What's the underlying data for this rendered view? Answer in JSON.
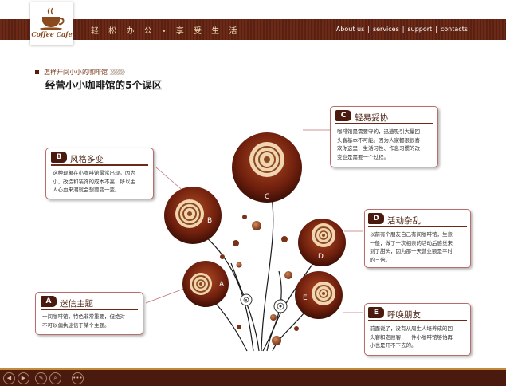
{
  "header": {
    "logo_text": "Coffee Cafe",
    "nav_cn": [
      "轻",
      "松",
      "办",
      "公",
      "享",
      "受",
      "生",
      "活"
    ],
    "nav_en": [
      "About us",
      "services",
      "support",
      "contacts"
    ]
  },
  "page": {
    "kicker": "怎样开间小小的咖啡馆",
    "kicker_arrows": "》》》》》》",
    "title": "经营小小咖啡馆的5个误区"
  },
  "tree": {
    "circle_labels": [
      "A",
      "B",
      "C",
      "D",
      "E"
    ]
  },
  "callouts": [
    {
      "id": "A",
      "title": "迷信主题",
      "lines": [
        "一间咖啡馆，特色非常重要，但绝对",
        "不可以偏执迷信于某个主题。"
      ]
    },
    {
      "id": "B",
      "title": "风格多变",
      "lines": [
        "这种现象在小咖啡馆最常出现。因为",
        "小，改造和装饰的成本不高，所以主",
        "人心血来潮就会想要变一变。"
      ]
    },
    {
      "id": "C",
      "title": "轻易妥协",
      "lines": [
        "咖啡馆是需要守的，迅速吸引大量回",
        "头客基本不可能。因为人家都很很喜",
        "欢你这里，生活习性、作息习惯的改",
        "变也是需要一个过程。"
      ]
    },
    {
      "id": "D",
      "title": "活动杂乱",
      "lines": [
        "以前有个朋友自己有间咖啡馆，生意",
        "一般，做了一次相亲的活动后感觉来",
        "到了甜头，因为那一天营业额是平时",
        "的三倍。"
      ]
    },
    {
      "id": "E",
      "title": "呼唤朋友",
      "lines": [
        "前面说了，没有从周生人培养成的回",
        "头客和老顾客，一件小咖啡馆够怕再",
        "小也是开不下去的。"
      ]
    }
  ],
  "colors": {
    "brand": "#6b2a17",
    "accent_dark": "#4a1a0e",
    "callout_border": "#b86c6c"
  },
  "controls": [
    "prev-icon",
    "next-icon",
    "pen-icon",
    "search-icon",
    "more-icon"
  ]
}
